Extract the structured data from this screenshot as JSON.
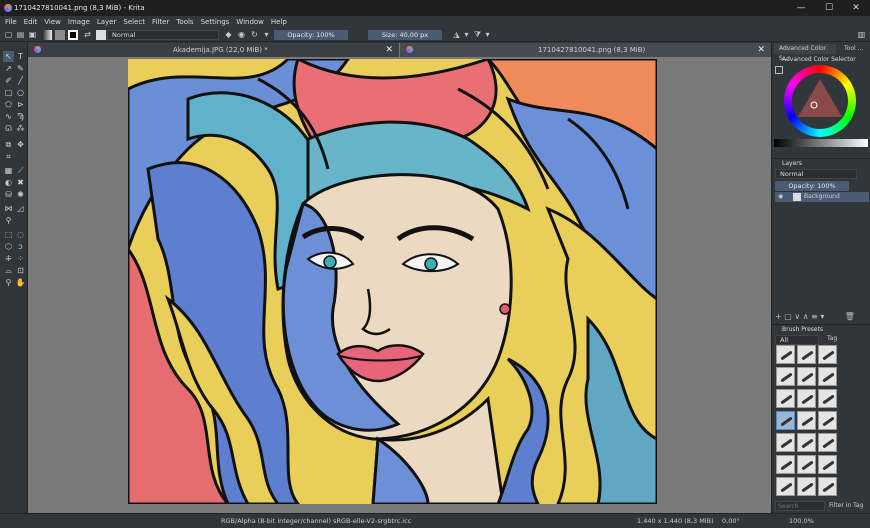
{
  "window": {
    "title": "17104278100​41.png (8,3 MiB) - Krita",
    "minimize": "—",
    "maximize": "☐",
    "close": "✕"
  },
  "menu": [
    "File",
    "Edit",
    "View",
    "Image",
    "Layer",
    "Select",
    "Filter",
    "Tools",
    "Settings",
    "Window",
    "Help"
  ],
  "toolbar": {
    "blend_mode": "Normal",
    "opacity_label": "Opacity: 100%",
    "size_label": "Size: 40,00 px"
  },
  "tabs": [
    {
      "label": "Akademija.JPG (22,0 MiB) *"
    },
    {
      "label": "1710427810041.png (8,3 MiB)"
    }
  ],
  "dock": {
    "color_tabs": [
      "Advanced Color S...",
      "Tool ..."
    ],
    "color_selector_title": "Advanced Color Selector",
    "layers_title": "Layers",
    "layer_blend": "Normal",
    "layer_opacity": "Opacity: 100%",
    "layer_name": "Background",
    "brush_title": "Brush Presets",
    "brush_filter": "All",
    "brush_tag": "Tag",
    "search_placeholder": "Search",
    "filter_in_tag": "Filter in Tag"
  },
  "status": {
    "color_info": "RGB/Alpha (8-bit integer/channel)  sRGB-elle-V2-srgbtrc.icc",
    "dimensions": "1.440 x 1.440 (8,3 MiB)",
    "rotation": "0,00°",
    "zoom": "100,0%"
  },
  "colors": {
    "accent": "#4a5c73",
    "panel": "#31363b",
    "canvas_bg": "#7a7a7a"
  }
}
